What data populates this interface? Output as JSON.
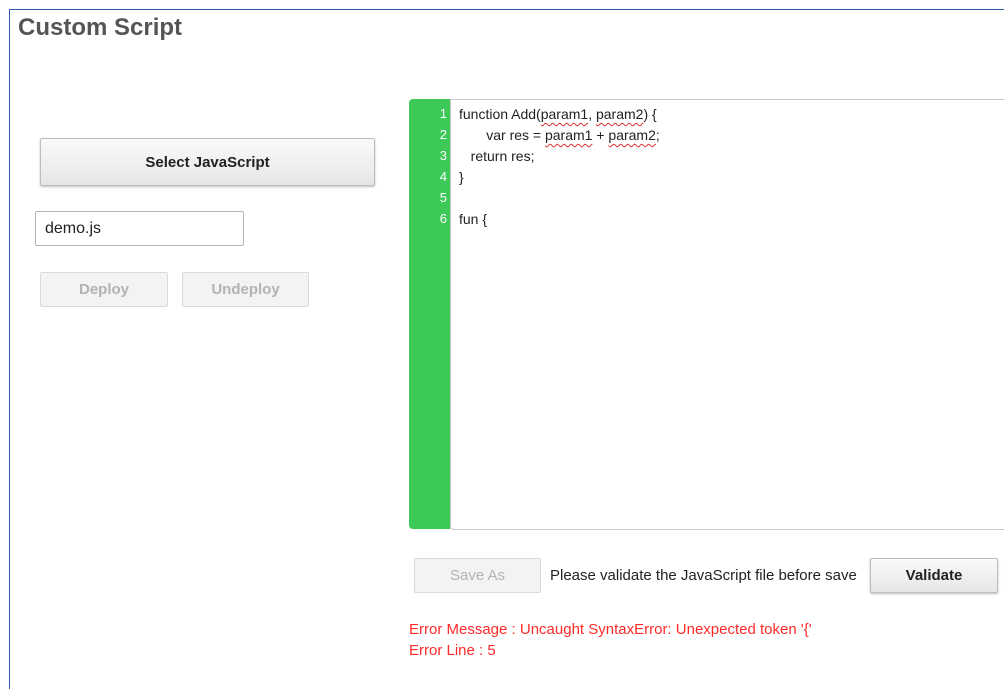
{
  "page": {
    "title": "Custom Script"
  },
  "left": {
    "select_button": "Select JavaScript",
    "file_name": "demo.js",
    "deploy_button": "Deploy",
    "undeploy_button": "Undeploy"
  },
  "editor": {
    "line_numbers": [
      "1",
      "2",
      "3",
      "4",
      "5",
      "6"
    ],
    "lines": {
      "l1_a": "function Add(",
      "l1_b": "param1",
      "l1_c": ", ",
      "l1_d": "param2",
      "l1_e": ") {",
      "l2_a": "       var res = ",
      "l2_b": "param1",
      "l2_c": " + ",
      "l2_d": "param2",
      "l2_e": ";",
      "l3": "   return res;",
      "l4": "}",
      "l5": "",
      "l6": "fun {"
    },
    "gutter_color": "#3cc958",
    "spellcheck_color": "#e03030"
  },
  "footer": {
    "save_as_button": "Save As",
    "validate_message": "Please validate the JavaScript file before save",
    "validate_button": "Validate"
  },
  "errors": {
    "message": "Error Message : Uncaught SyntaxError: Unexpected token '{'",
    "line": "Error Line : 5",
    "color": "#ff2a2a"
  }
}
